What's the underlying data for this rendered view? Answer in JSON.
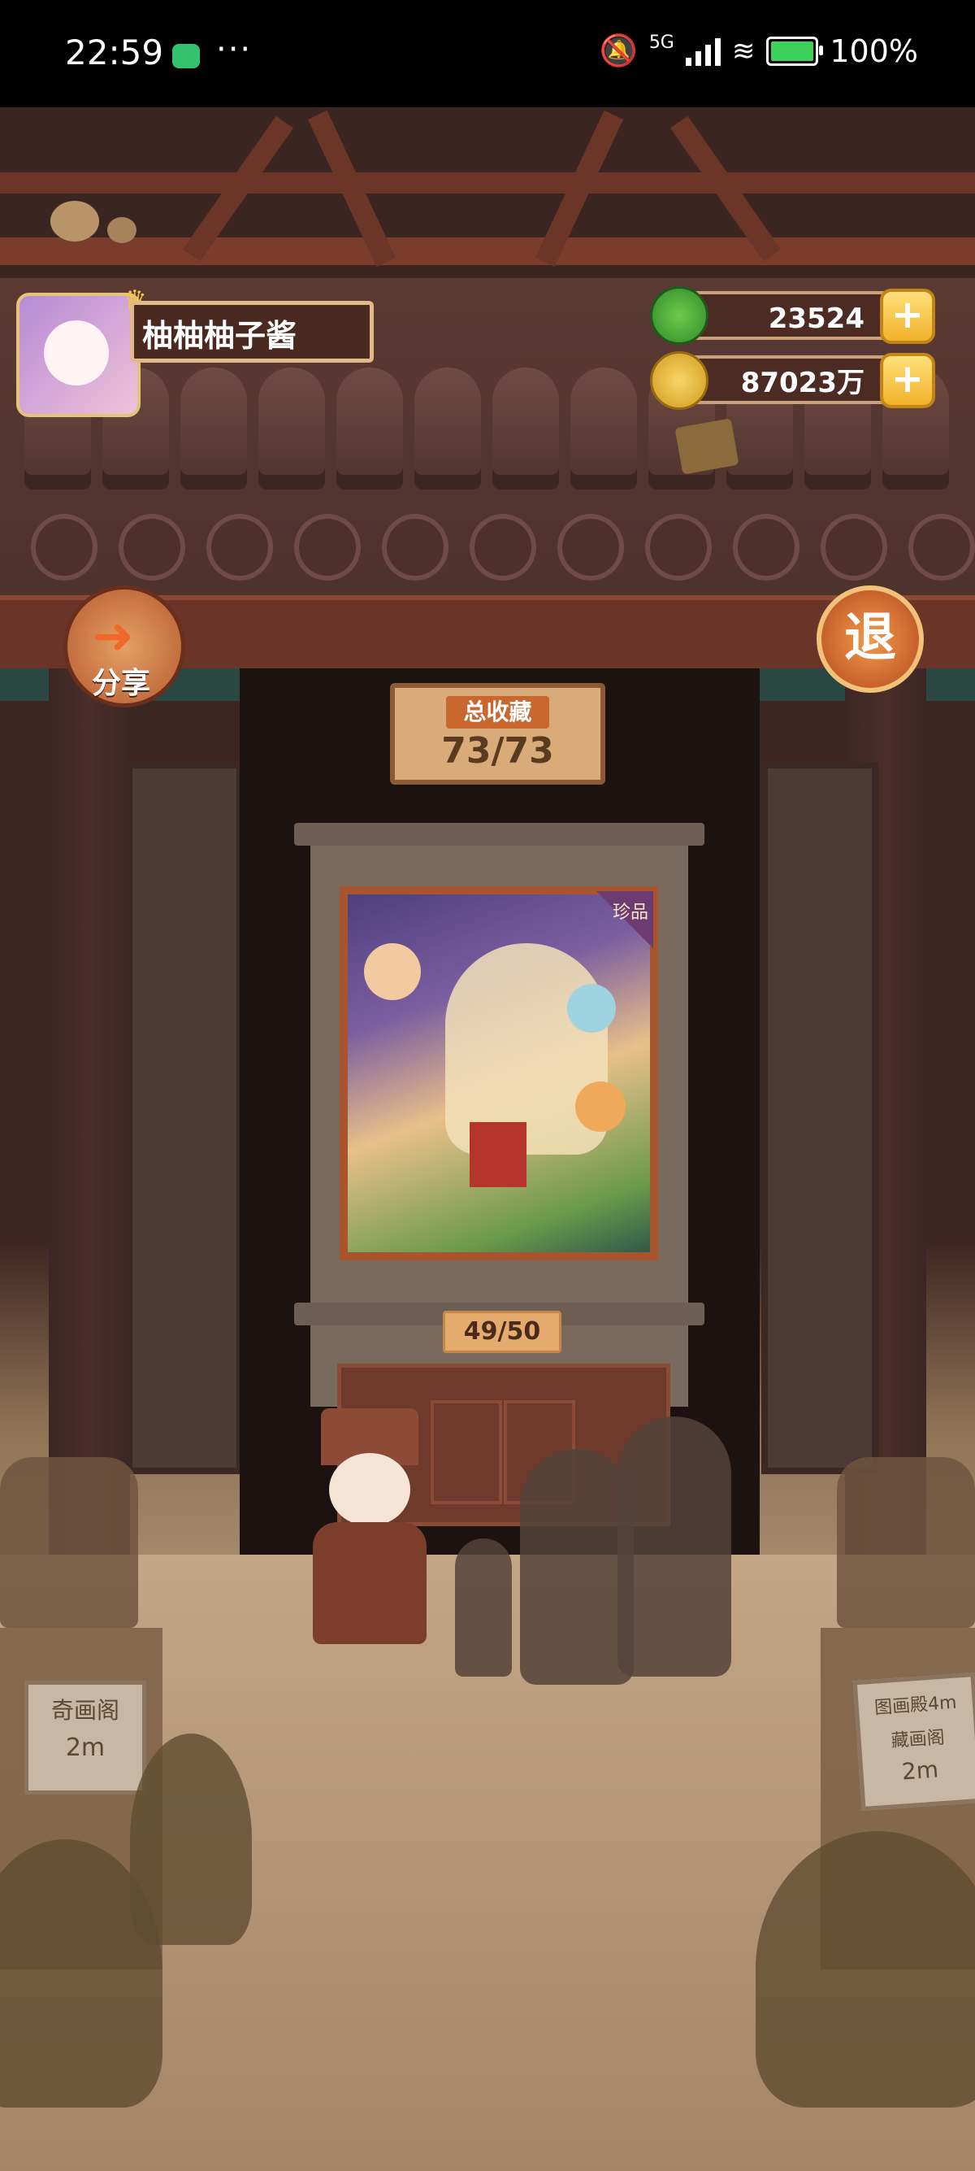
{
  "status_bar": {
    "time": "22:59",
    "dots": "···",
    "network": "5G",
    "battery": "100%"
  },
  "profile": {
    "player_name": "柚柚柚子酱"
  },
  "currency": {
    "jade": "23524",
    "coins": "87023万"
  },
  "buttons": {
    "share_label": "分享",
    "exit_label": "退"
  },
  "collection": {
    "title": "总收藏",
    "count": "73/73"
  },
  "painting": {
    "badge": "珍品",
    "progress": "49/50"
  },
  "signs": {
    "left_name": "奇画阁",
    "left_distance": "2m",
    "right_line1": "图画殿4m",
    "right_line2": "藏画阁",
    "right_distance": "2m"
  },
  "colors": {
    "accent_gold": "#e2b98a",
    "plus_yellow": "#f2b22c",
    "jade_green": "#3f9a3a"
  }
}
